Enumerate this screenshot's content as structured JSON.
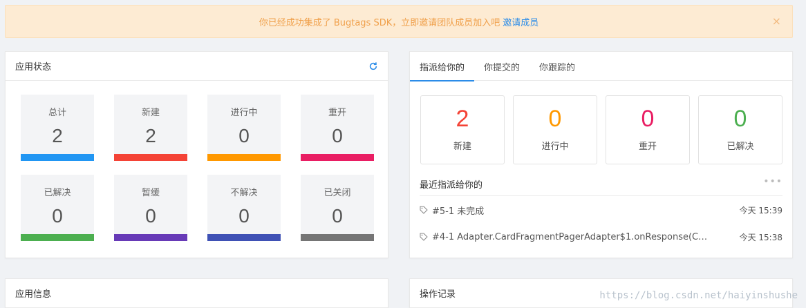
{
  "banner": {
    "message": "你已经成功集成了 Bugtags SDK，立即邀请团队成员加入吧",
    "invite_link": "邀请成员",
    "close": "×"
  },
  "app_status": {
    "title": "应用状态",
    "items": [
      {
        "label": "总计",
        "value": "2",
        "color": "#2196f3"
      },
      {
        "label": "新建",
        "value": "2",
        "color": "#f44336"
      },
      {
        "label": "进行中",
        "value": "0",
        "color": "#ff9800"
      },
      {
        "label": "重开",
        "value": "0",
        "color": "#e91e63"
      },
      {
        "label": "已解决",
        "value": "0",
        "color": "#4caf50"
      },
      {
        "label": "暂缓",
        "value": "0",
        "color": "#673ab7"
      },
      {
        "label": "不解决",
        "value": "0",
        "color": "#3f51b5"
      },
      {
        "label": "已关闭",
        "value": "0",
        "color": "#757575"
      }
    ]
  },
  "assigned": {
    "tabs": [
      {
        "label": "指派给你的",
        "active": true
      },
      {
        "label": "你提交的",
        "active": false
      },
      {
        "label": "你跟踪的",
        "active": false
      }
    ],
    "counts": [
      {
        "value": "2",
        "label": "新建",
        "color": "#f44336"
      },
      {
        "value": "0",
        "label": "进行中",
        "color": "#ff9800"
      },
      {
        "value": "0",
        "label": "重开",
        "color": "#e91e63"
      },
      {
        "value": "0",
        "label": "已解决",
        "color": "#4caf50"
      }
    ],
    "recent_title": "最近指派给你的",
    "more": "•••",
    "issues": [
      {
        "title": "#5-1 未完成",
        "time": "今天 15:39"
      },
      {
        "title": "#4-1 Adapter.CardFragmentPagerAdapter$1.onResponse(Car...",
        "time": "今天 15:38"
      }
    ]
  },
  "app_info": {
    "title": "应用信息"
  },
  "operations": {
    "title": "操作记录",
    "more": "•••"
  },
  "watermark": "https://blog.csdn.net/haiyinshushe"
}
